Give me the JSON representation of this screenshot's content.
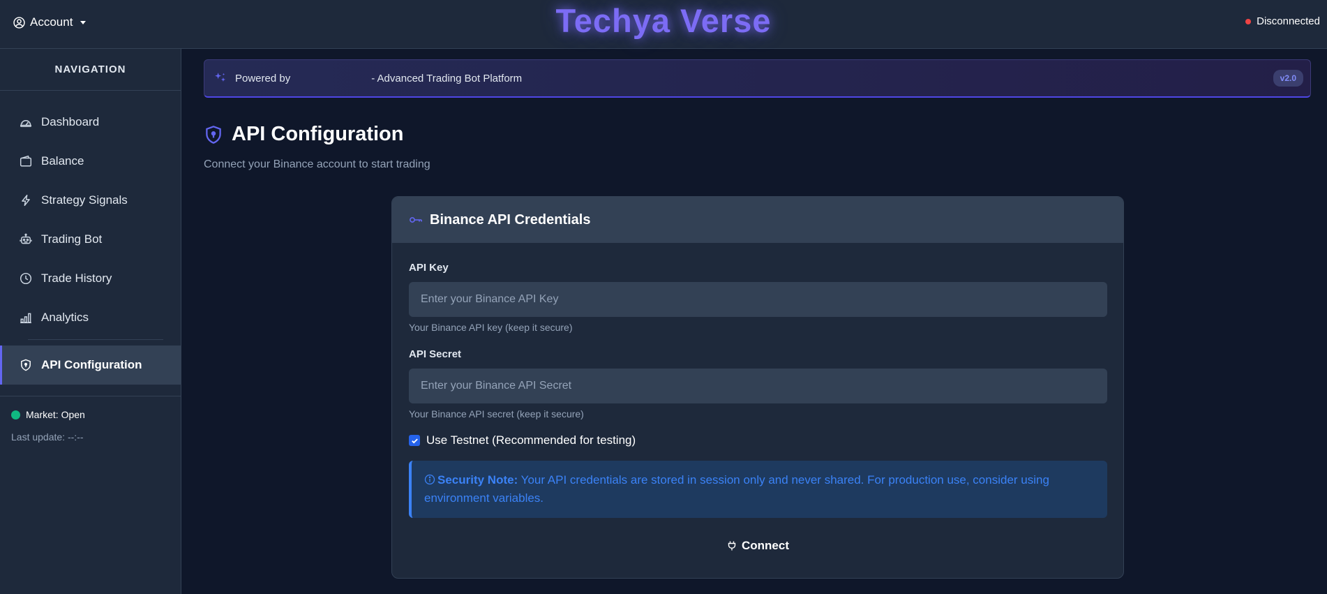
{
  "header": {
    "account_label": "Account",
    "brand": "Techya Verse",
    "status_text": "Disconnected",
    "status_color": "#ef4444"
  },
  "sidebar": {
    "heading": "NAVIGATION",
    "items": [
      {
        "label": "Dashboard",
        "icon": "gauge-icon"
      },
      {
        "label": "Balance",
        "icon": "wallet-icon"
      },
      {
        "label": "Strategy Signals",
        "icon": "lightning-icon"
      },
      {
        "label": "Trading Bot",
        "icon": "robot-icon"
      },
      {
        "label": "Trade History",
        "icon": "clock-icon"
      },
      {
        "label": "Analytics",
        "icon": "bar-chart-icon"
      },
      {
        "label": "API Configuration",
        "icon": "shield-lock-icon",
        "active": true
      }
    ],
    "market_status": "Market: Open",
    "market_color": "#10b981",
    "last_update": "Last update: --:--"
  },
  "banner": {
    "powered_by": "Powered by",
    "tagline": "- Advanced Trading Bot Platform",
    "version": "v2.0"
  },
  "page": {
    "title": "API Configuration",
    "subtitle": "Connect your Binance account to start trading"
  },
  "card": {
    "title": "Binance API Credentials",
    "api_key": {
      "label": "API Key",
      "value": "",
      "placeholder": "Enter your Binance API Key",
      "help": "Your Binance API key (keep it secure)"
    },
    "api_secret": {
      "label": "API Secret",
      "value": "",
      "placeholder": "Enter your Binance API Secret",
      "help": "Your Binance API secret (keep it secure)"
    },
    "testnet": {
      "label": "Use Testnet (Recommended for testing)",
      "checked": true
    },
    "note": {
      "title": "Security Note:",
      "text": "Your API credentials are stored in session only and never shared. For production use, consider using environment variables."
    },
    "connect_label": "Connect"
  },
  "colors": {
    "accent": "#6366f1",
    "info": "#3b82f6"
  }
}
